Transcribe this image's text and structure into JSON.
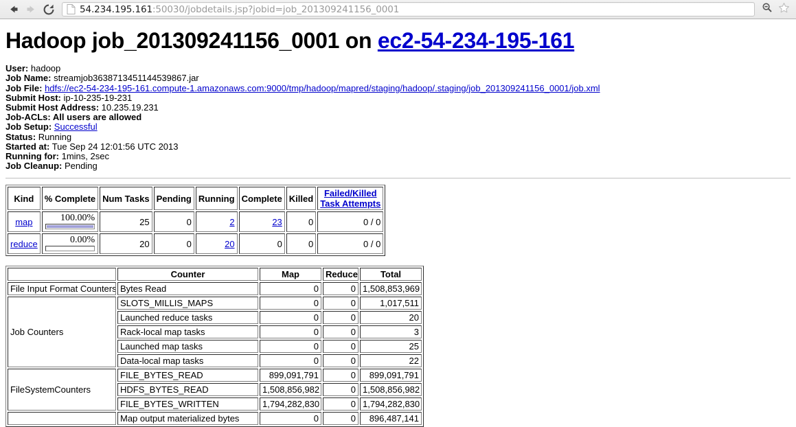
{
  "browser": {
    "back_icon": "back-arrow-icon",
    "forward_icon": "forward-arrow-icon",
    "reload_icon": "reload-icon",
    "page_icon": "page-document-icon",
    "url_host": "54.234.195.161",
    "url_rest": ":50030/jobdetails.jsp?jobid=job_201309241156_0001",
    "zoom_out_icon": "zoom-out-magnifier-icon",
    "bookmark_icon": "bookmark-star-icon"
  },
  "page": {
    "title_prefix": "Hadoop job_201309241156_0001 on ",
    "title_host_link": "ec2-54-234-195-161",
    "meta": [
      {
        "label": "User:",
        "value": "hadoop",
        "link": false
      },
      {
        "label": "Job Name:",
        "value": "streamjob3638713451144539867.jar",
        "link": false
      },
      {
        "label": "Job File:",
        "value": "hdfs://ec2-54-234-195-161.compute-1.amazonaws.com:9000/tmp/hadoop/mapred/staging/hadoop/.staging/job_201309241156_0001/job.xml",
        "link": true
      },
      {
        "label": "Submit Host:",
        "value": "ip-10-235-19-231",
        "link": false
      },
      {
        "label": "Submit Host Address:",
        "value": "10.235.19.231",
        "link": false
      },
      {
        "label": "Job-ACLs: All users are allowed",
        "value": "",
        "link": false,
        "all_bold": true
      },
      {
        "label": "Job Setup:",
        "value": "Successful",
        "link": true
      },
      {
        "label": "Status:",
        "value": "Running",
        "link": false
      },
      {
        "label": "Started at:",
        "value": "Tue Sep 24 12:01:56 UTC 2013",
        "link": false
      },
      {
        "label": "Running for:",
        "value": "1mins, 2sec",
        "link": false
      },
      {
        "label": "Job Cleanup:",
        "value": "Pending",
        "link": false
      }
    ]
  },
  "tasks_table": {
    "headers": [
      "Kind",
      "% Complete",
      "Num Tasks",
      "Pending",
      "Running",
      "Complete",
      "Killed",
      "Failed/Killed"
    ],
    "header_last_line2": "Task Attempts",
    "rows": [
      {
        "kind": "map",
        "percent_label": "100.00%",
        "percent_value": 100,
        "num_tasks": "25",
        "pending": "0",
        "running": "2",
        "running_link": true,
        "complete": "23",
        "complete_link": true,
        "killed": "0",
        "failed_killed": "0 / 0"
      },
      {
        "kind": "reduce",
        "percent_label": "0.00%",
        "percent_value": 0,
        "num_tasks": "20",
        "pending": "0",
        "running": "20",
        "running_link": true,
        "complete": "0",
        "complete_link": false,
        "killed": "0",
        "failed_killed": "0 / 0"
      }
    ]
  },
  "counters_table": {
    "headers": [
      "",
      "Counter",
      "Map",
      "Reduce",
      "Total"
    ],
    "groups": [
      {
        "name": "File Input Format Counters",
        "rows": [
          {
            "counter": "Bytes Read",
            "map": "0",
            "reduce": "0",
            "total": "1,508,853,969"
          }
        ]
      },
      {
        "name": "Job Counters",
        "rows": [
          {
            "counter": "SLOTS_MILLIS_MAPS",
            "map": "0",
            "reduce": "0",
            "total": "1,017,511"
          },
          {
            "counter": "Launched reduce tasks",
            "map": "0",
            "reduce": "0",
            "total": "20"
          },
          {
            "counter": "Rack-local map tasks",
            "map": "0",
            "reduce": "0",
            "total": "3"
          },
          {
            "counter": "Launched map tasks",
            "map": "0",
            "reduce": "0",
            "total": "25"
          },
          {
            "counter": "Data-local map tasks",
            "map": "0",
            "reduce": "0",
            "total": "22"
          }
        ]
      },
      {
        "name": "FileSystemCounters",
        "rows": [
          {
            "counter": "FILE_BYTES_READ",
            "map": "899,091,791",
            "reduce": "0",
            "total": "899,091,791"
          },
          {
            "counter": "HDFS_BYTES_READ",
            "map": "1,508,856,982",
            "reduce": "0",
            "total": "1,508,856,982"
          },
          {
            "counter": "FILE_BYTES_WRITTEN",
            "map": "1,794,282,830",
            "reduce": "0",
            "total": "1,794,282,830"
          }
        ]
      },
      {
        "name": "",
        "rows": [
          {
            "counter": "Map output materialized bytes",
            "map": "0",
            "reduce": "0",
            "total": "896,487,141"
          }
        ]
      }
    ]
  },
  "colors": {
    "link": "#0000cc",
    "progress_fill": "#a0a0d8",
    "chrome_bg": "#eeeeee"
  }
}
